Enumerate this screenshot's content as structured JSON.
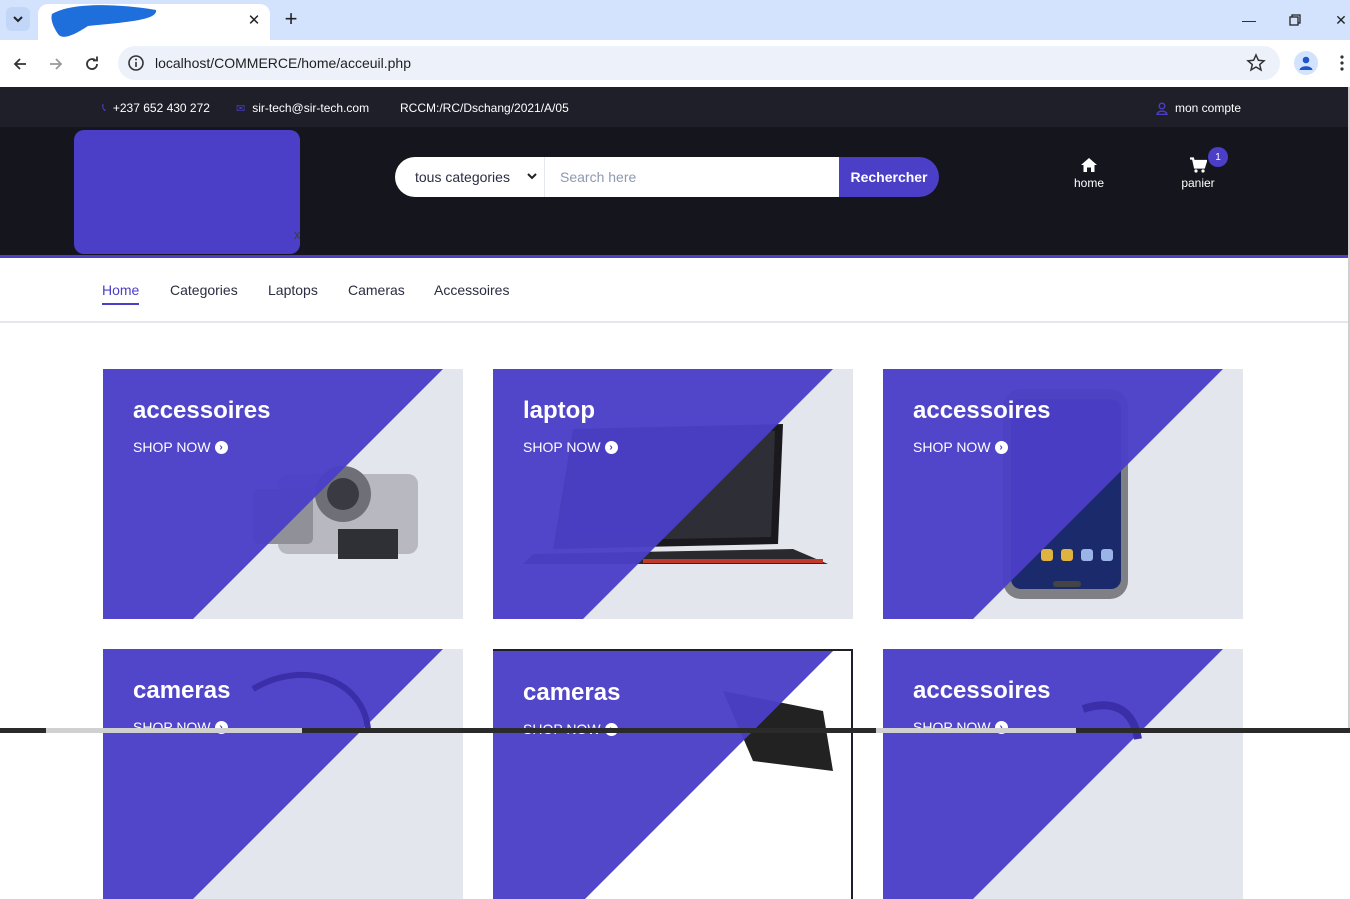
{
  "browser": {
    "url": "localhost/COMMERCE/home/acceuil.php"
  },
  "topbar": {
    "phone": "+237 652 430 272",
    "email": "sir-tech@sir-tech.com",
    "rccm": "RCCM:/RC/Dschang/2021/A/05",
    "account": "mon compte"
  },
  "header": {
    "logo_char": "x",
    "category_select": "tous categories",
    "search_placeholder": "Search here",
    "search_button": "Rechercher",
    "home_label": "home",
    "cart_label": "panier",
    "cart_count": "1"
  },
  "nav": {
    "items": [
      "Home",
      "Categories",
      "Laptops",
      "Cameras",
      "Accessoires"
    ]
  },
  "cards": [
    {
      "title": "accessoires",
      "cta": "SHOP NOW",
      "icon": "camera-image"
    },
    {
      "title": "laptop",
      "cta": "SHOP NOW",
      "icon": "laptop-image"
    },
    {
      "title": "accessoires",
      "cta": "SHOP NOW",
      "icon": "phone-image"
    },
    {
      "title": "cameras",
      "cta": "SHOP NOW",
      "icon": "camera-image"
    },
    {
      "title": "cameras",
      "cta": "SHOP NOW",
      "icon": "camera-image"
    },
    {
      "title": "accessoires",
      "cta": "SHOP NOW",
      "icon": "watch-image"
    }
  ],
  "colors": {
    "accent": "#4b3ec7",
    "topbar": "#1e1f29",
    "header": "#15161d",
    "card_bg": "#e4e6ed"
  }
}
